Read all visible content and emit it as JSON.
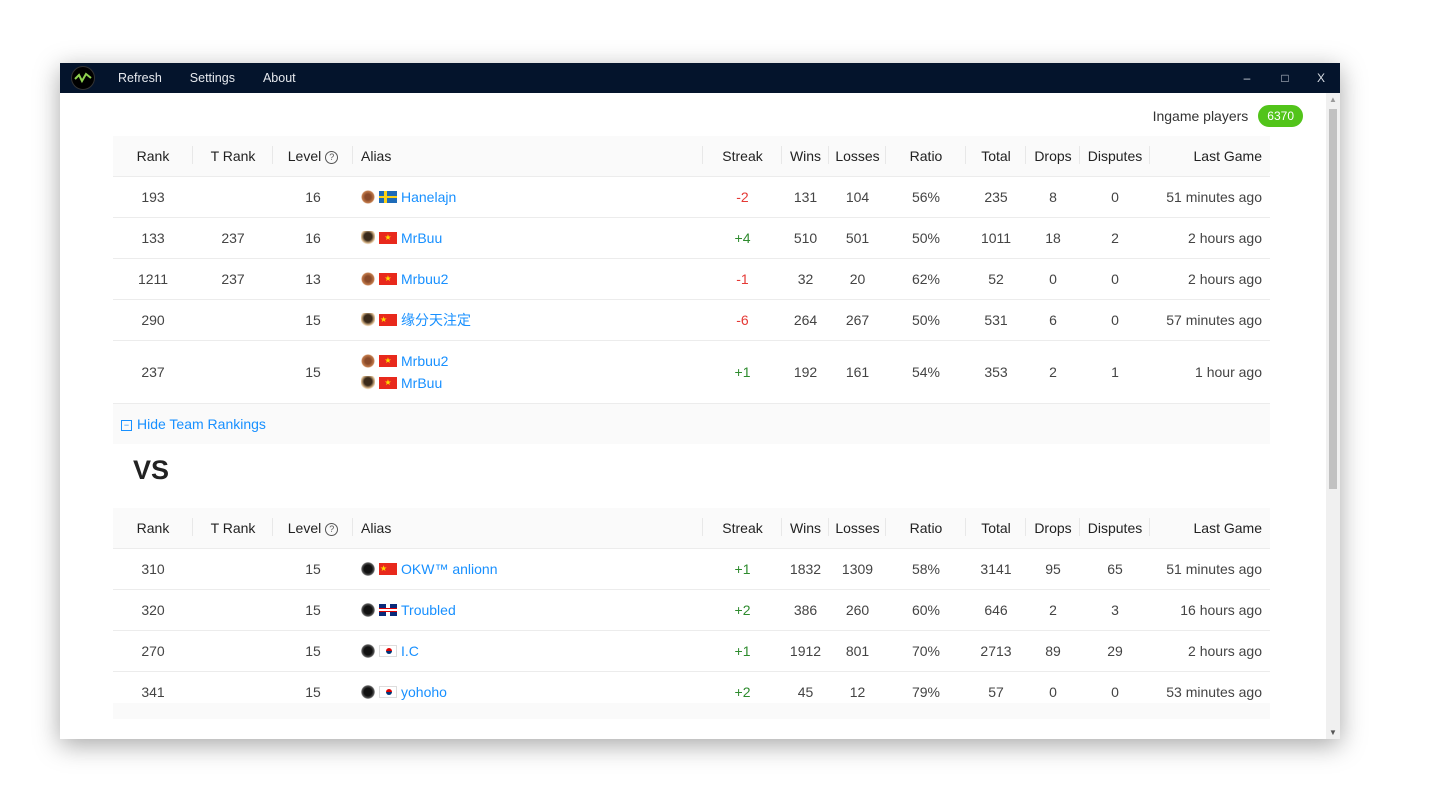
{
  "menu": {
    "items": [
      "Refresh",
      "Settings",
      "About"
    ]
  },
  "window_controls": {
    "minimize": "–",
    "maximize": "□",
    "close": "X"
  },
  "ingame": {
    "label": "Ingame players",
    "count": "6370"
  },
  "columns": [
    "Rank",
    "T Rank",
    "Level",
    "Alias",
    "Streak",
    "Wins",
    "Losses",
    "Ratio",
    "Total",
    "Drops",
    "Disputes",
    "Last Game"
  ],
  "team1": {
    "rows": [
      {
        "rank": "193",
        "trank": "",
        "level": "16",
        "players": [
          {
            "race": "orc",
            "flag": "se",
            "name": "Hanelajn"
          }
        ],
        "streak": "-2",
        "wins": "131",
        "losses": "104",
        "ratio": "56%",
        "total": "235",
        "drops": "8",
        "disputes": "0",
        "last": "51 minutes ago"
      },
      {
        "rank": "133",
        "trank": "237",
        "level": "16",
        "players": [
          {
            "race": "hum",
            "flag": "vn",
            "name": "MrBuu"
          }
        ],
        "streak": "+4",
        "wins": "510",
        "losses": "501",
        "ratio": "50%",
        "total": "1011",
        "drops": "18",
        "disputes": "2",
        "last": "2 hours ago"
      },
      {
        "rank": "1211",
        "trank": "237",
        "level": "13",
        "players": [
          {
            "race": "orc",
            "flag": "vn",
            "name": "Mrbuu2"
          }
        ],
        "streak": "-1",
        "wins": "32",
        "losses": "20",
        "ratio": "62%",
        "total": "52",
        "drops": "0",
        "disputes": "0",
        "last": "2 hours ago"
      },
      {
        "rank": "290",
        "trank": "",
        "level": "15",
        "players": [
          {
            "race": "hum",
            "flag": "cn",
            "name": "缘分天注定"
          }
        ],
        "streak": "-6",
        "wins": "264",
        "losses": "267",
        "ratio": "50%",
        "total": "531",
        "drops": "6",
        "disputes": "0",
        "last": "57 minutes ago"
      },
      {
        "rank": "237",
        "trank": "",
        "level": "15",
        "players": [
          {
            "race": "orc",
            "flag": "vn",
            "name": "Mrbuu2"
          },
          {
            "race": "hum",
            "flag": "vn",
            "name": "MrBuu"
          }
        ],
        "streak": "+1",
        "wins": "192",
        "losses": "161",
        "ratio": "54%",
        "total": "353",
        "drops": "2",
        "disputes": "1",
        "last": "1 hour ago"
      }
    ],
    "toggle_label": "Hide Team Rankings"
  },
  "vs_label": "VS",
  "team2": {
    "rows": [
      {
        "rank": "310",
        "trank": "",
        "level": "15",
        "players": [
          {
            "race": "ud",
            "flag": "cn",
            "name": "OKW™ anlionn"
          }
        ],
        "streak": "+1",
        "wins": "1832",
        "losses": "1309",
        "ratio": "58%",
        "total": "3141",
        "drops": "95",
        "disputes": "65",
        "last": "51 minutes ago"
      },
      {
        "rank": "320",
        "trank": "",
        "level": "15",
        "players": [
          {
            "race": "ud",
            "flag": "gb",
            "name": "Troubled"
          }
        ],
        "streak": "+2",
        "wins": "386",
        "losses": "260",
        "ratio": "60%",
        "total": "646",
        "drops": "2",
        "disputes": "3",
        "last": "16 hours ago"
      },
      {
        "rank": "270",
        "trank": "",
        "level": "15",
        "players": [
          {
            "race": "ud",
            "flag": "kr",
            "name": "I.C"
          }
        ],
        "streak": "+1",
        "wins": "1912",
        "losses": "801",
        "ratio": "70%",
        "total": "2713",
        "drops": "89",
        "disputes": "29",
        "last": "2 hours ago"
      },
      {
        "rank": "341",
        "trank": "",
        "level": "15",
        "players": [
          {
            "race": "ud",
            "flag": "kr",
            "name": "yohoho"
          }
        ],
        "streak": "+2",
        "wins": "45",
        "losses": "12",
        "ratio": "79%",
        "total": "57",
        "drops": "0",
        "disputes": "0",
        "last": "53 minutes ago"
      }
    ]
  }
}
